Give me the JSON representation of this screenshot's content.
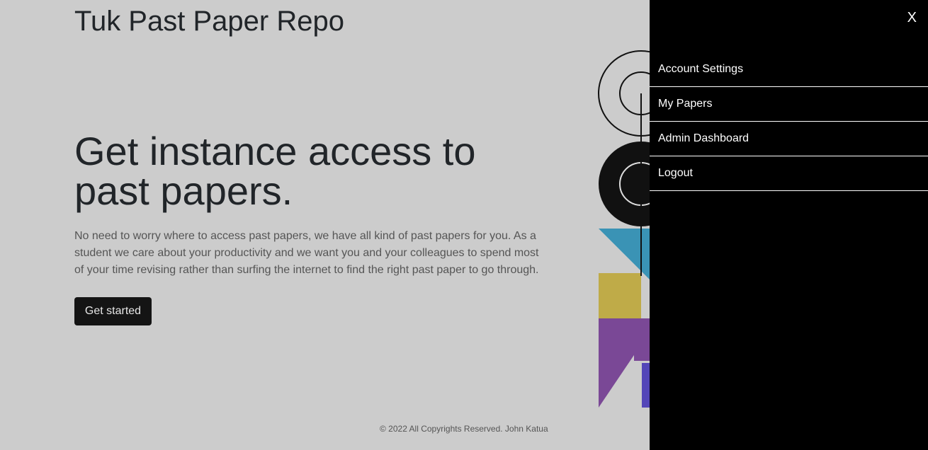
{
  "header": {
    "brand": "Tuk Past Paper Repo"
  },
  "hero": {
    "heading": "Get instance access to past papers.",
    "description": "No need to worry where to access past papers, we have all kind of past papers for you. As a student we care about your productivity and we want you and your colleagues to spend most of your time revising rather than surfing the internet to find the right past paper to go through.",
    "cta_label": "Get started"
  },
  "footer": {
    "copyright": "© 2022 All Copyrights Reserved. John Katua"
  },
  "drawer": {
    "close_label": "X",
    "items": [
      {
        "label": "Account Settings"
      },
      {
        "label": "My Papers"
      },
      {
        "label": "Admin Dashboard"
      },
      {
        "label": "Logout"
      }
    ]
  },
  "colors": {
    "page_bg": "#cccccc",
    "drawer_bg": "#000000",
    "button_bg": "#141414",
    "art_blue": "#3a93b5",
    "art_gold": "#bfab48",
    "art_purple": "#7a4896",
    "art_indigo": "#5346b8"
  }
}
